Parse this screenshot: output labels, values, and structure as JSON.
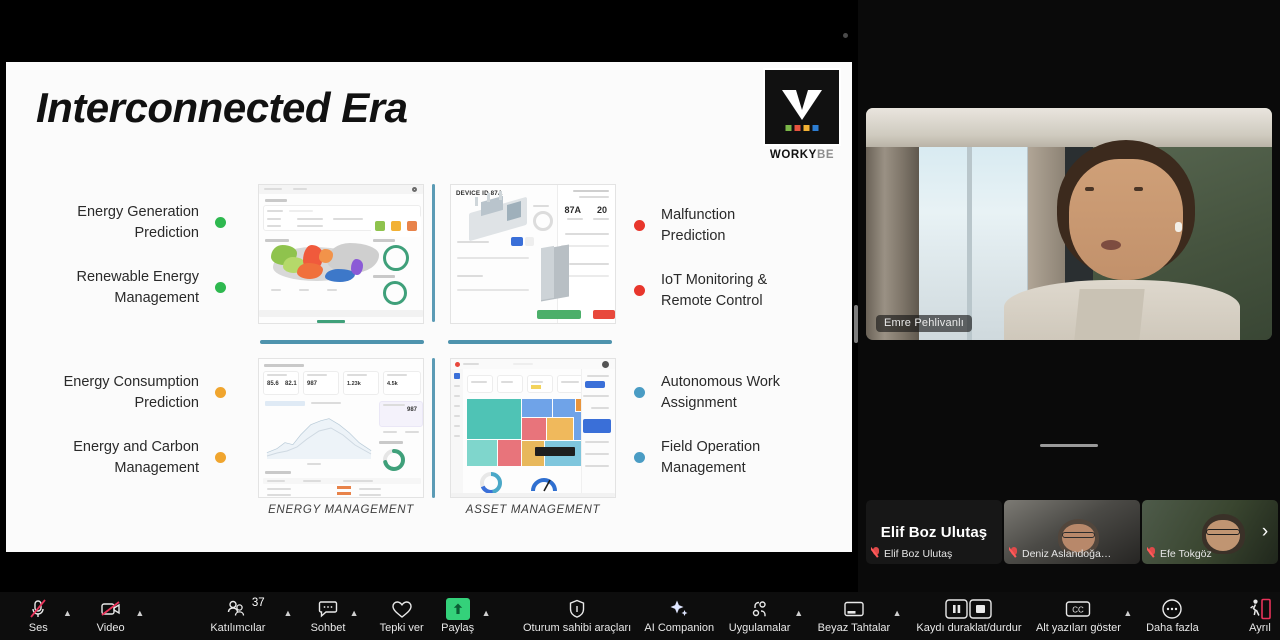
{
  "meeting": {
    "active_speaker": "Emre Pehlivanlı",
    "participant_count": "37"
  },
  "slide": {
    "title": "Interconnected Era",
    "logo": {
      "name_primary": "WORKY",
      "name_secondary": "BE",
      "mark": "w-logo-icon",
      "dot_colors": [
        "#7ab648",
        "#e8543f",
        "#f2b134",
        "#2d7dd2"
      ]
    },
    "left_features": [
      {
        "label": "Energy Generation\nPrediction",
        "line1": "Energy Generation",
        "line2": "Prediction",
        "color": "#2eb84f"
      },
      {
        "label": "Renewable Energy\nManagement",
        "line1": "Renewable Energy",
        "line2": "Management",
        "color": "#2eb84f"
      },
      {
        "label": "Energy Consumption\nPrediction",
        "line1": "Energy Consumption",
        "line2": "Prediction",
        "color": "#f0a52e"
      },
      {
        "label": "Energy and Carbon\nManagement",
        "line1": "Energy and Carbon",
        "line2": "Management",
        "color": "#f0a52e"
      }
    ],
    "right_features": [
      {
        "line1": "Malfunction",
        "line2": "Prediction",
        "color": "#e8362c"
      },
      {
        "line1": "IoT Monitoring &",
        "line2": "Remote Control",
        "color": "#e8362c"
      },
      {
        "line1": "Autonomous Work",
        "line2": "Assignment",
        "color": "#4a9cc4"
      },
      {
        "line1": "Field Operation",
        "line2": "Management",
        "color": "#4a9cc4"
      }
    ],
    "captions": {
      "left": "ENERGY MANAGEMENT",
      "right": "ASSET MANAGEMENT"
    },
    "thumbnails": {
      "asset_device_title": "DEVICE ID 87A",
      "asset_stat_1_value": "87A",
      "asset_stat_2_value": "20"
    },
    "divider_color": "#5b9bb5"
  },
  "participants_strip": [
    {
      "name": "Elif Boz Ulutaş",
      "label": "Elif Boz Ulutaş",
      "muted": true,
      "video_off": true
    },
    {
      "name": "Deniz Aslandoğa…",
      "label": "Deniz Aslandoğa…",
      "muted": true,
      "video_off": false
    },
    {
      "name": "Efe Tokgöz",
      "label": "Efe Tokgöz",
      "muted": true,
      "video_off": false
    }
  ],
  "strip_next_icon": "chevron-right-icon",
  "toolbar": [
    {
      "id": "audio",
      "label": "Ses",
      "icon": "microphone-muted-icon",
      "caret": true,
      "state": "muted"
    },
    {
      "id": "video",
      "label": "Video",
      "icon": "camera-off-icon",
      "caret": true,
      "state": "off"
    },
    {
      "id": "participants",
      "label": "Katılımcılar",
      "icon": "participants-icon",
      "caret": true,
      "badge": "37"
    },
    {
      "id": "chat",
      "label": "Sohbet",
      "icon": "chat-bubble-icon",
      "caret": true
    },
    {
      "id": "reactions",
      "label": "Tepki ver",
      "icon": "heart-icon",
      "caret": false
    },
    {
      "id": "share",
      "label": "Paylaş",
      "icon": "share-screen-icon",
      "caret": true,
      "state": "sharing"
    },
    {
      "id": "host-tools",
      "label": "Oturum sahibi araçları",
      "icon": "shield-icon",
      "caret": false
    },
    {
      "id": "ai-companion",
      "label": "AI Companion",
      "icon": "sparkle-icon",
      "caret": false
    },
    {
      "id": "apps",
      "label": "Uygulamalar",
      "icon": "apps-icon",
      "caret": true
    },
    {
      "id": "whiteboards",
      "label": "Beyaz Tahtalar",
      "icon": "whiteboard-icon",
      "caret": true
    },
    {
      "id": "record",
      "label": "Kaydı duraklat/durdur",
      "icon": "pause-stop-recording-icon",
      "caret": false
    },
    {
      "id": "captions",
      "label": "Alt yazıları göster",
      "icon": "closed-caption-icon",
      "caret": true
    },
    {
      "id": "more",
      "label": "Daha fazla",
      "icon": "ellipsis-icon",
      "caret": false
    },
    {
      "id": "leave",
      "label": "Ayrıl",
      "icon": "leave-meeting-icon",
      "caret": false
    }
  ]
}
